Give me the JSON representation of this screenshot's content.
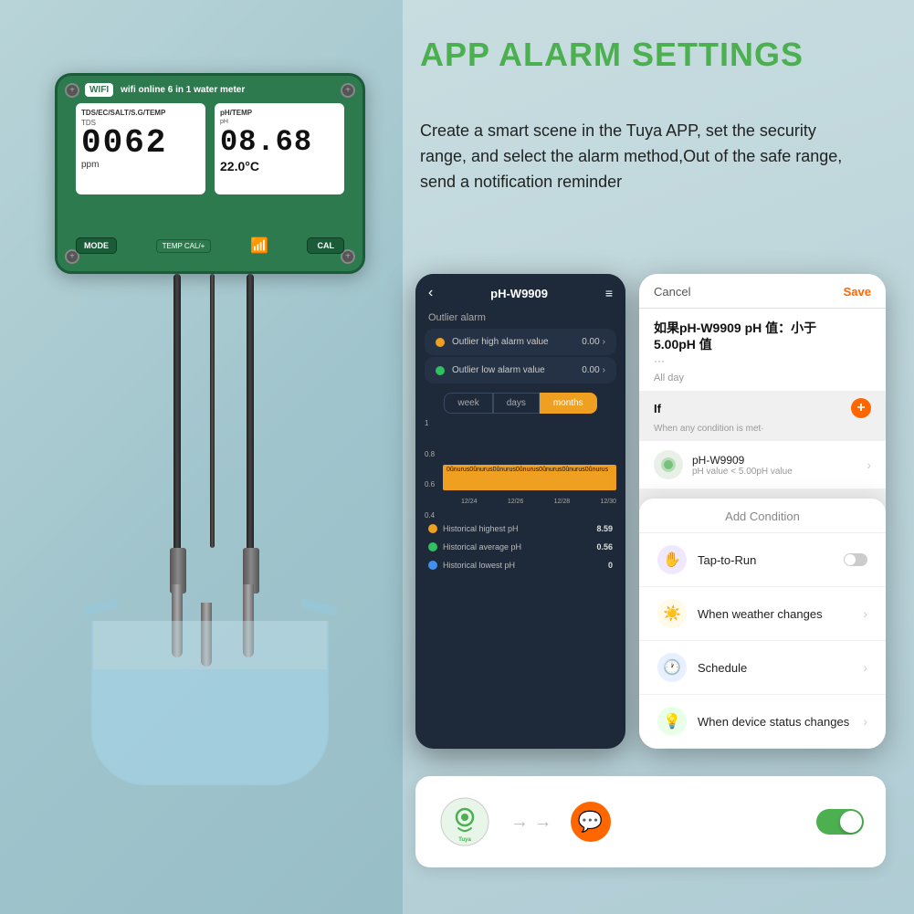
{
  "page": {
    "title": "APP ALARM SETTINGS",
    "description": "Create a smart scene in the Tuya APP, set the security range, and select the alarm method,Out of the safe range, send a notification reminder"
  },
  "device": {
    "wifi_label": "WIFI",
    "model_text": "wifi online 6 in 1 water meter",
    "left_display_labels": "TDS/EC/SALT/S.G/TEMP",
    "right_display_labels": "pH/TEMP",
    "tds_value": "0062",
    "tds_unit": "ppm",
    "ph_value": "08.68",
    "temp_value": "22.0°C",
    "btn_mode": "MODE",
    "btn_cal": "CAL",
    "btn_temp_cal": "TEMP CAL/+"
  },
  "phone_left": {
    "back": "‹",
    "title": "pH-W9909",
    "menu": "≡",
    "section_outlier": "Outlier alarm",
    "alarm_high_label": "Outlier high alarm value",
    "alarm_high_value": "0.00",
    "alarm_low_label": "Outlier low alarm value",
    "alarm_low_value": "0.00",
    "tab_week": "week",
    "tab_days": "days",
    "tab_months": "months",
    "chart_y_labels": [
      "1",
      "0.8",
      "0.6",
      "0.4"
    ],
    "chart_x_labels": [
      "12/24",
      "12/26",
      "12/28",
      "12/30"
    ],
    "chart_bar_text": "0ûnurus0ûnurus0ûnurus0ûnurus0ûnurus0ûnurus0ûnurus0ûnurus0ûnurus0ûnurus",
    "stat_high_label": "Historical highest pH",
    "stat_high_value": "8.59",
    "stat_avg_label": "Historical average pH",
    "stat_avg_value": "0.56",
    "stat_low_label": "Historical lowest pH",
    "stat_low_value": "0"
  },
  "phone_right": {
    "cancel": "Cancel",
    "save": "Save",
    "condition_title": "如果pH-W9909 pH 值：小于\n5.00pH 值",
    "condition_dots": "···",
    "allday": "All day",
    "if_label": "If",
    "when_any": "When any condition is met·",
    "ph_device": "pH-W9909",
    "ph_sub": "pH value < 5.00pH value",
    "modal_title": "Add Condition",
    "modal_tap_label": "Tap-to-Run",
    "modal_weather_label": "When weather changes",
    "modal_schedule_label": "Schedule",
    "modal_device_label": "When device status changes"
  },
  "bottom_card": {
    "arrow": "→",
    "message_icon": "💬"
  },
  "colors": {
    "green_accent": "#4caf50",
    "orange_accent": "#f0a020",
    "device_green": "#2d7a4f",
    "phone_dark_bg": "#1e2a3a",
    "toggle_on": "#4caf50"
  }
}
